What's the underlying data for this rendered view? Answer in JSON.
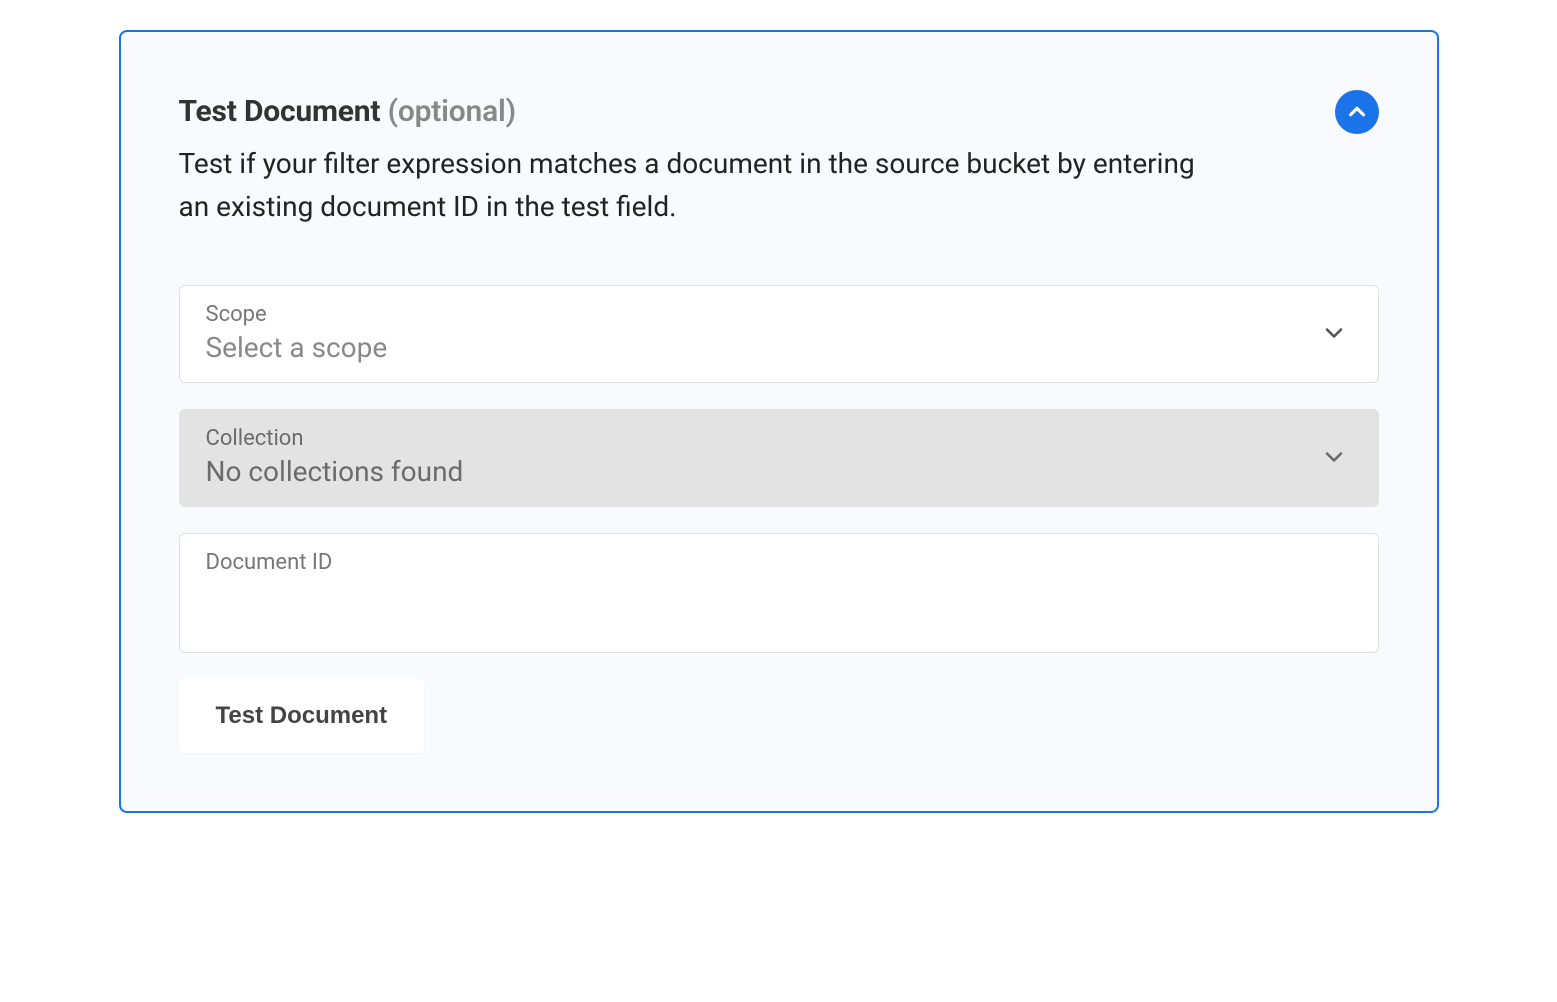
{
  "panel": {
    "title": "Test Document",
    "optional": "(optional)",
    "description": "Test if your filter expression matches a document in the source bucket by entering an existing document ID in the test field."
  },
  "fields": {
    "scope": {
      "label": "Scope",
      "value": "Select a scope"
    },
    "collection": {
      "label": "Collection",
      "value": "No collections found"
    },
    "document_id": {
      "label": "Document ID",
      "value": ""
    }
  },
  "actions": {
    "test_button": "Test Document"
  }
}
